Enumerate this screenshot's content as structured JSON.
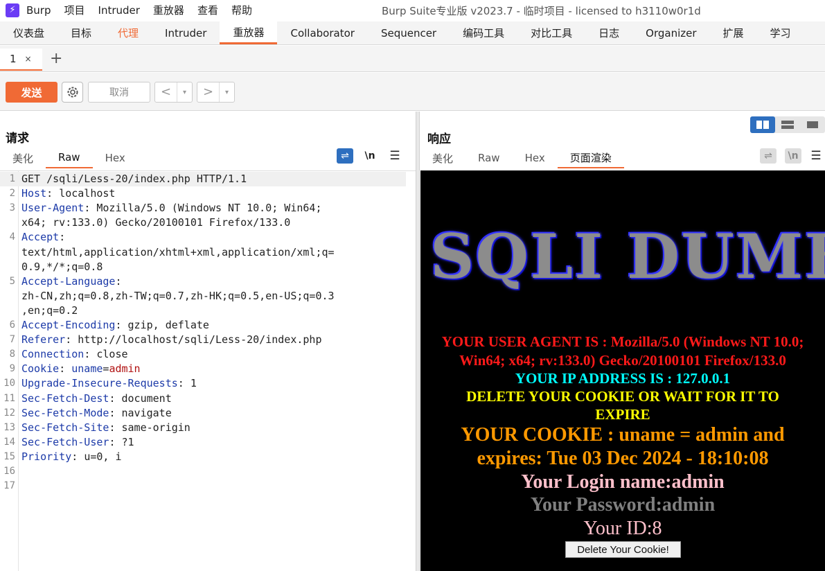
{
  "app": {
    "logo_glyph": "⚡",
    "menu": [
      "Burp",
      "项目",
      "Intruder",
      "重放器",
      "查看",
      "帮助"
    ],
    "window_title": "Burp Suite专业版  v2023.7 - 临时项目 - licensed to h3110w0r1d"
  },
  "tool_tabs": [
    "仪表盘",
    "目标",
    "代理",
    "Intruder",
    "重放器",
    "Collaborator",
    "Sequencer",
    "编码工具",
    "对比工具",
    "日志",
    "Organizer",
    "扩展",
    "学习"
  ],
  "repeater": {
    "tab_label": "1",
    "tab_close": "×",
    "add_tab": "+"
  },
  "toolbar": {
    "send_label": "发送",
    "cancel_label": "取消",
    "back_glyph": "<",
    "forward_glyph": ">",
    "dropdown_glyph": "▾"
  },
  "request": {
    "title": "请求",
    "tabs": [
      "美化",
      "Raw",
      "Hex"
    ],
    "active_tab": "Raw",
    "icon_wrap": "⇌",
    "icon_newline": "\\n",
    "icon_menu": "☰",
    "lines": [
      {
        "n": "1",
        "k": "",
        "v": "GET /sqli/Less-20/index.php HTTP/1.1"
      },
      {
        "n": "2",
        "k": "Host",
        "v": "localhost"
      },
      {
        "n": "3",
        "k": "User-Agent",
        "v": "Mozilla/5.0 (Windows NT 10.0; Win64;"
      },
      {
        "n": "",
        "k": "",
        "v": "x64; rv:133.0) Gecko/20100101 Firefox/133.0"
      },
      {
        "n": "4",
        "k": "Accept",
        "v": ""
      },
      {
        "n": "",
        "k": "",
        "v": "text/html,application/xhtml+xml,application/xml;q="
      },
      {
        "n": "",
        "k": "",
        "v": "0.9,*/*;q=0.8"
      },
      {
        "n": "5",
        "k": "Accept-Language",
        "v": ""
      },
      {
        "n": "",
        "k": "",
        "v": "zh-CN,zh;q=0.8,zh-TW;q=0.7,zh-HK;q=0.5,en-US;q=0.3"
      },
      {
        "n": "",
        "k": "",
        "v": ",en;q=0.2"
      },
      {
        "n": "6",
        "k": "Accept-Encoding",
        "v": "gzip, deflate"
      },
      {
        "n": "7",
        "k": "Referer",
        "v": "http://localhost/sqli/Less-20/index.php"
      },
      {
        "n": "8",
        "k": "Connection",
        "v": "close"
      },
      {
        "n": "9",
        "k": "Cookie",
        "v": "",
        "ck": "uname",
        "cv": "admin"
      },
      {
        "n": "10",
        "k": "Upgrade-Insecure-Requests",
        "v": "1"
      },
      {
        "n": "11",
        "k": "Sec-Fetch-Dest",
        "v": "document"
      },
      {
        "n": "12",
        "k": "Sec-Fetch-Mode",
        "v": "navigate"
      },
      {
        "n": "13",
        "k": "Sec-Fetch-Site",
        "v": "same-origin"
      },
      {
        "n": "14",
        "k": "Sec-Fetch-User",
        "v": "?1"
      },
      {
        "n": "15",
        "k": "Priority",
        "v": "u=0, i"
      },
      {
        "n": "16",
        "k": "",
        "v": ""
      },
      {
        "n": "17",
        "k": "",
        "v": ""
      }
    ]
  },
  "response": {
    "title": "响应",
    "tabs": [
      "美化",
      "Raw",
      "Hex",
      "页面渲染"
    ],
    "active_tab": "页面渲染",
    "icon_wrap": "⇌",
    "icon_newline": "\\n",
    "icon_menu": "☰",
    "render": {
      "banner": "SQLI DUMB SERIES",
      "ua_line1": "YOUR USER AGENT IS : Mozilla/5.0 (Windows NT 10.0;",
      "ua_line2": "Win64; x64; rv:133.0) Gecko/20100101 Firefox/133.0",
      "ip_line": "YOUR IP ADDRESS IS : 127.0.0.1",
      "delete_line1": "DELETE YOUR COOKIE OR WAIT FOR IT TO",
      "delete_line2": "EXPIRE",
      "cookie_line1": "YOUR COOKIE : uname = admin and",
      "cookie_line2": "expires: Tue 03 Dec 2024 - 18:10:08",
      "login_name": "Your Login name:admin",
      "password": "Your Password:admin",
      "user_id": "Your ID:8",
      "delete_button": "Delete Your Cookie!"
    },
    "colors": {
      "ua": "#ff1a1a",
      "ip": "#00ffff",
      "delete": "#ffff00",
      "cookie": "#ff9900",
      "login": "#ffc0cb",
      "password": "#808080",
      "id": "#ffc0cb"
    }
  },
  "colors": {
    "accent": "#f06a35",
    "active_blue": "#2e6fbf"
  }
}
